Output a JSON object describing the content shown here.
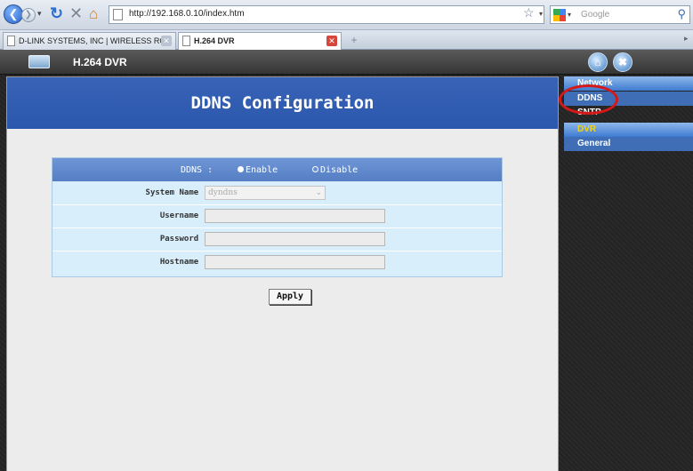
{
  "browser": {
    "url": "http://192.168.0.10/index.htm",
    "search_placeholder": "Google",
    "tabs": [
      {
        "title": "D-LINK SYSTEMS, INC | WIRELESS RO..."
      },
      {
        "title": "H.264 DVR"
      }
    ],
    "new_tab_symbol": "+"
  },
  "app": {
    "title": "H.264 DVR",
    "page_title": "DDNS Configuration",
    "ddns": {
      "label": "DDNS :",
      "options": [
        "Enable",
        "Disable"
      ],
      "selected": "Disable"
    },
    "fields": {
      "system_name": {
        "label": "System Name :",
        "value": "dyndns"
      },
      "username": {
        "label": "Username :",
        "value": ""
      },
      "password": {
        "label": "Password :",
        "value": ""
      },
      "hostname": {
        "label": "Hostname :",
        "value": ""
      }
    },
    "apply_label": "Apply"
  },
  "sidemenu": {
    "network": "Network",
    "ddns": "DDNS",
    "sntp": "SNTP",
    "dvr": "DVR",
    "general": "General"
  },
  "colors": {
    "banner": "#2b57ac",
    "form_bg": "#d8eefb",
    "menu_blue": "#3e7bd1",
    "dvr_text": "#f2d21a",
    "highlight": "#d51818"
  },
  "icons": [
    "back-icon",
    "forward-icon",
    "reload-icon",
    "stop-icon",
    "home-icon",
    "page-icon",
    "star-icon",
    "google-icon",
    "search-icon",
    "tab-close-icon",
    "dvr-logo-icon",
    "home-button-icon",
    "logout-icon"
  ]
}
